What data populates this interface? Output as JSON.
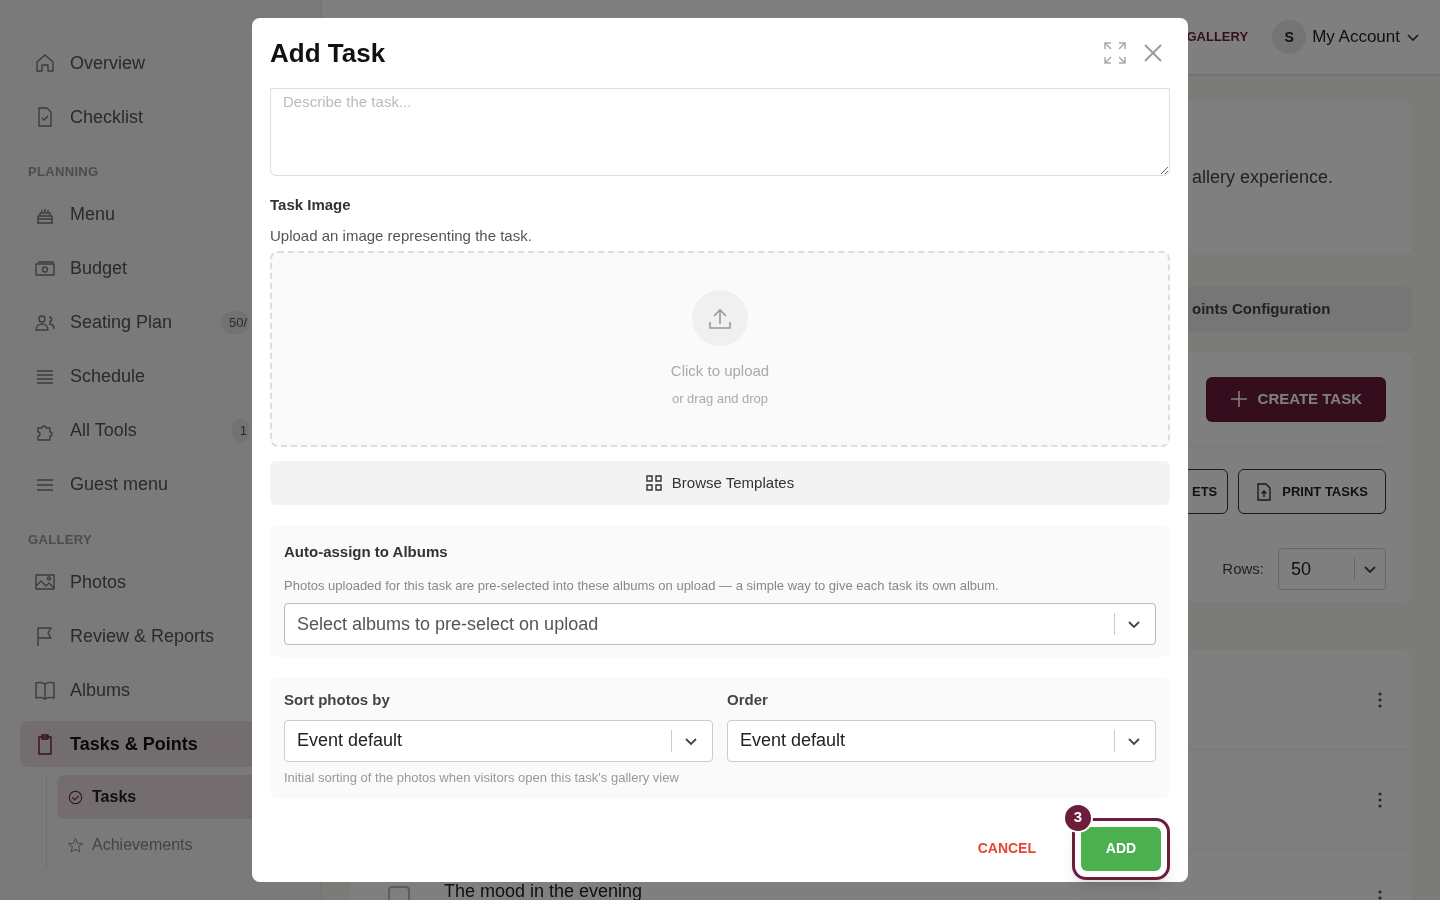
{
  "sidebar": {
    "sections": [
      {
        "items": [
          {
            "label": "Overview",
            "selected": false
          },
          {
            "label": "Checklist",
            "selected": false
          }
        ]
      },
      {
        "heading": "PLANNING",
        "items": [
          {
            "label": "Menu",
            "selected": false
          },
          {
            "label": "Budget",
            "selected": false
          },
          {
            "label": "Seating Plan",
            "badge": "50/",
            "selected": false
          },
          {
            "label": "Schedule",
            "selected": false
          },
          {
            "label": "All Tools",
            "badge": "1",
            "selected": false
          },
          {
            "label": "Guest menu",
            "selected": false
          }
        ]
      },
      {
        "heading": "GALLERY",
        "items": [
          {
            "label": "Photos",
            "selected": false
          },
          {
            "label": "Review & Reports",
            "selected": false
          },
          {
            "label": "Albums",
            "selected": false
          },
          {
            "label": "Tasks & Points",
            "selected": true,
            "children": [
              {
                "label": "Tasks",
                "selected": true
              },
              {
                "label": "Achievements",
                "selected": false
              }
            ]
          }
        ]
      }
    ]
  },
  "header": {
    "gallery_link": "GALLERY",
    "account": {
      "avatar": "S",
      "label": "My Account"
    }
  },
  "background": {
    "intro_text": "allery experience.",
    "config_tab": "oints Configuration",
    "create_button": "CREATE TASK",
    "toolbar_buttons": [
      "ETS",
      "PRINT TASKS"
    ],
    "rows_label": "Rows:",
    "rows_value": "50",
    "last_row": {
      "title": "The mood in the evening",
      "checked": false
    }
  },
  "modal": {
    "title": "Add Task",
    "description_placeholder": "Describe the task...",
    "image": {
      "label": "Task Image",
      "hint": "Upload an image representing the task.",
      "upload_title": "Click to upload",
      "upload_subtitle": "or drag and drop"
    },
    "browse_button": "Browse Templates",
    "albums": {
      "label": "Auto-assign to Albums",
      "help": "Photos uploaded for this task are pre-selected into these albums on upload — a simple way to give each task its own album.",
      "placeholder": "Select albums to pre-select on upload"
    },
    "sort": {
      "label": "Sort photos by",
      "value": "Event default"
    },
    "order": {
      "label": "Order",
      "value": "Event default"
    },
    "sort_help": "Initial sorting of the photos when visitors open this task's gallery view",
    "cancel": "CANCEL",
    "add": "ADD",
    "step_badge": "3"
  }
}
